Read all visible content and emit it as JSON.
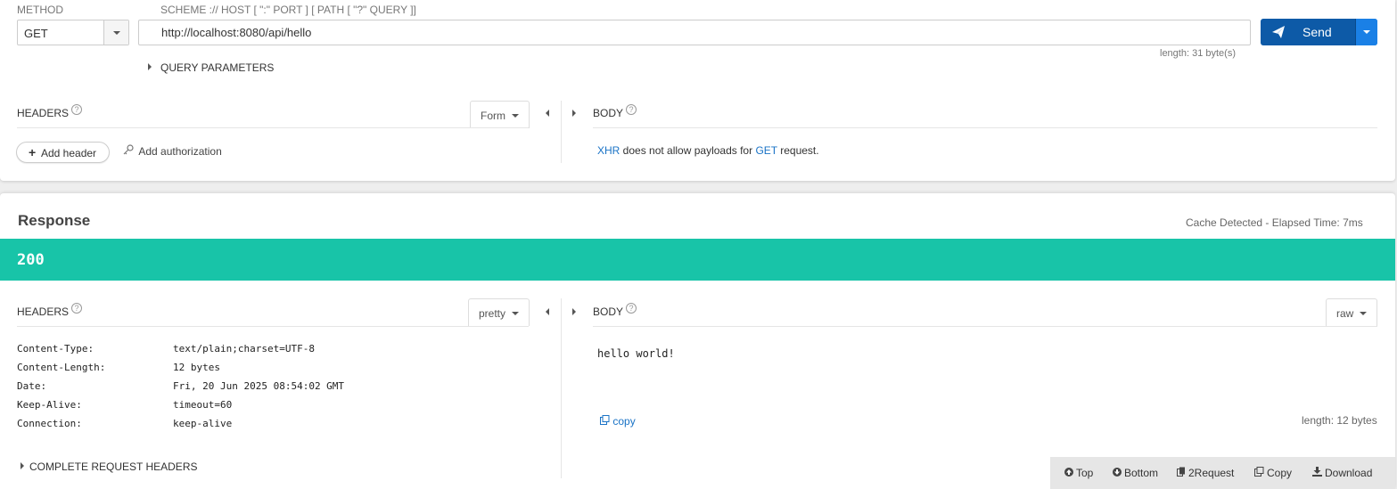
{
  "request": {
    "method_label": "METHOD",
    "method_value": "GET",
    "url_hint": "SCHEME :// HOST [ \":\" PORT ] [ PATH [ \"?\" QUERY ]]",
    "url_value": "http://localhost:8080/api/hello",
    "length_text": "length: 31 byte(s)",
    "send_label": "Send",
    "query_params_label": "QUERY PARAMETERS",
    "headers_title": "HEADERS",
    "headers_mode": "Form",
    "body_title": "BODY",
    "add_header_label": "Add header",
    "add_auth_label": "Add authorization",
    "body_msg": {
      "xhr": "XHR",
      "middle": " does not allow payloads for ",
      "get": "GET",
      "end": " request."
    }
  },
  "response": {
    "title": "Response",
    "cache_text": "Cache Detected - Elapsed Time: 7ms",
    "status_code": "200",
    "status_color": "#18c4a8",
    "headers_title": "HEADERS",
    "headers_mode": "pretty",
    "body_title": "BODY",
    "body_mode": "raw",
    "headers": [
      {
        "name": "Content-Type:",
        "value": "text/plain;charset=UTF-8"
      },
      {
        "name": "Content-Length:",
        "value": "12 bytes"
      },
      {
        "name": "Date:",
        "value": "Fri, 20 Jun 2025 08:54:02 GMT"
      },
      {
        "name": "Keep-Alive:",
        "value": "timeout=60"
      },
      {
        "name": "Connection:",
        "value": "keep-alive"
      }
    ],
    "complete_headers_label": "COMPLETE REQUEST HEADERS",
    "body_text": "hello world!",
    "copy_label": "copy",
    "length_text": "length: 12 bytes"
  },
  "footer": {
    "top": "Top",
    "bottom": "Bottom",
    "to_request": "2Request",
    "copy": "Copy",
    "download": "Download"
  },
  "colors": {
    "accent": "#0d5aa7",
    "link": "#1a73c6"
  }
}
